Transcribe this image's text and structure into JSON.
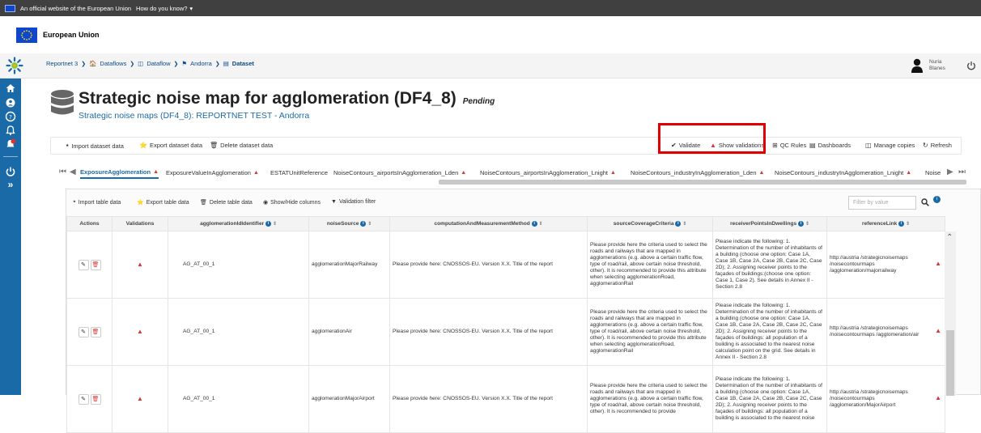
{
  "eu_bar": {
    "notice": "An official website of the European Union",
    "how_link": "How do you know?"
  },
  "eu_header": {
    "name": "European Union"
  },
  "breadcrumb": [
    {
      "label": "Reportnet 3"
    },
    {
      "label": "Dataflows"
    },
    {
      "label": "Dataflow"
    },
    {
      "label": "Andorra"
    },
    {
      "label": "Dataset"
    }
  ],
  "user": {
    "first": "Nuria",
    "last": "Blanes"
  },
  "dataset": {
    "title": "Strategic noise map for agglomeration (DF4_8)",
    "status": "Pending",
    "subtitle": "Strategic noise maps (DF4_8): REPORTNET TEST - Andorra"
  },
  "toolbar": {
    "import": "Import dataset data",
    "export": "Export dataset data",
    "delete": "Delete dataset data",
    "validate": "Validate",
    "show_validations": "Show validations",
    "qc_rules": "QC Rules",
    "dashboards": "Dashboards",
    "manage_copies": "Manage copies",
    "refresh": "Refresh"
  },
  "tabs": [
    {
      "label": "ExposureAgglomeration",
      "warn": true,
      "active": true
    },
    {
      "label": "ExposureValueInAgglomeration",
      "warn": true
    },
    {
      "label": "ESTATUnitReference",
      "warn": false
    },
    {
      "label": "NoiseContours_airportsInAgglomeration_Lden",
      "warn": true
    },
    {
      "label": "NoiseContours_airportsInAgglomeration_Lnight",
      "warn": true
    },
    {
      "label": "NoiseContours_industryInAgglomeration_Lden",
      "warn": true
    },
    {
      "label": "NoiseContours_industryInAgglomeration_Lnight",
      "warn": true
    },
    {
      "label": "Noise",
      "warn": false
    }
  ],
  "table_toolbar": {
    "import": "Import table data",
    "export": "Export table data",
    "delete": "Delete table data",
    "show_hide": "Show/Hide columns",
    "validation_filter": "Validation filter",
    "filter_placeholder": "Filter by value"
  },
  "columns": [
    "Actions",
    "Validations",
    "agglomerationIdIdentifier",
    "noiseSource",
    "computationAndMeasurementMethod",
    "sourceCoverageCriteria",
    "receiverPointsInDwellings",
    "referenceLink"
  ],
  "rows": [
    {
      "agg_id": "AG_AT_00_1",
      "noise_source": "agglomerationMajorRailway",
      "method": "Please provide here: CNOSSOS-EU. Version X.X. Title of the report",
      "coverage": "Please provide here the criteria used to select the roads and railways that are mapped in agglomerations (e.g. above a certain traffic flow, type of road/rail, above certain noise threshold, other). It is recommended to provide this attribute when selecting agglomerationRoad, agglomerationRail",
      "receiver": "Please indicate the following: 1. Determination of the number of inhabitants of a building (choose one option: Case 1A, Case 1B, Case 2A, Case 2B, Case 2C, Case 2D); 2. Assigning receiver points to the façades of buildings:(choose one option: Case 1, Case 2). See details in Annex II - Section 2.8",
      "ref": "http://austria /strategicnoisemaps /noisecontourmaps /agglomeration/majorrailway"
    },
    {
      "agg_id": "AG_AT_00_1",
      "noise_source": "agglomerationAir",
      "method": "Please provide here: CNOSSOS-EU. Version X.X. Title of the report",
      "coverage": "Please provide here the criteria used to select the roads and railways that are mapped in agglomerations (e.g. above a certain traffic flow, type of road/rail, above certain noise threshold, other). It is recommended to provide this attribute when selecting agglomerationRoad, agglomerationRail",
      "receiver": "Please indicate the following: 1. Determination of the number of inhabitants of a building (choose one option: Case 1A, Case 1B, Case 2A, Case 2B, Case 2C, Case 2D); 2. Assigning receiver points to the façades of buildings: all population of a building is associated to the nearest noise calculation point on the grid. See details in Annex II - Section 2.8",
      "ref": "http://austria /strategicnoisemaps /noisecontourmaps /agglomeration/air"
    },
    {
      "agg_id": "AG_AT_00_1",
      "noise_source": "agglomerationMajorAirport",
      "method": "Please provide here: CNOSSOS-EU. Version X.X. Title of the report",
      "coverage": "Please provide here the criteria used to select the roads and railways that are mapped in agglomerations (e.g. above a certain traffic flow, type of road/rail, above certain noise threshold, other). It is recommended to provide",
      "receiver": "Please indicate the following: 1. Determination of the number of inhabitants of a building (choose one option: Case 1A, Case 1B, Case 2A, Case 2B, Case 2C, Case 2D); 2. Assigning receiver points to the façades of buildings: all population of a building is associated to the nearest noise",
      "ref": "http://austria /strategicnoisemaps /noisecontourmaps /agglomeration/MajorAirport"
    }
  ]
}
